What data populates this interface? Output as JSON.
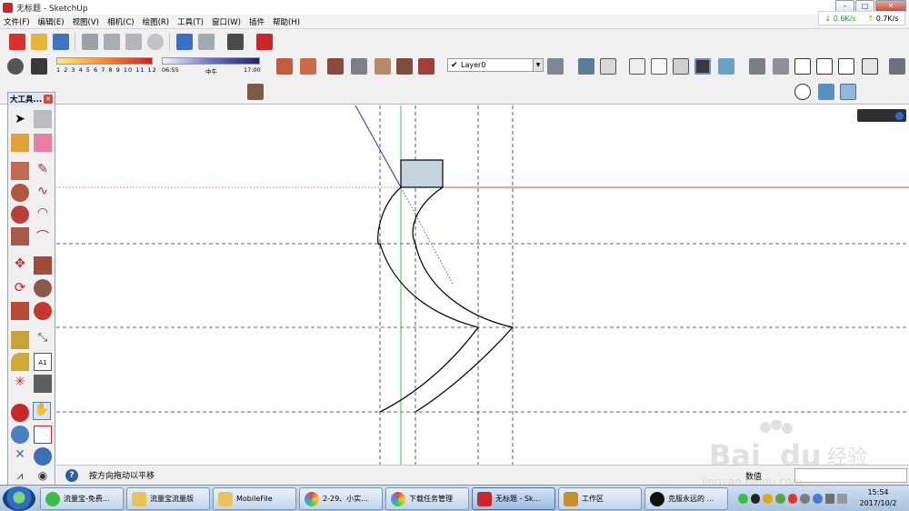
{
  "window": {
    "title": "无标题 - SketchUp",
    "controls": [
      "–",
      "□",
      "✕"
    ]
  },
  "net_widget": {
    "down": "0.6K/s",
    "up": "0.7K/s"
  },
  "menu": [
    "文件(F)",
    "编辑(E)",
    "视图(V)",
    "相机(C)",
    "绘图(R)",
    "工具(T)",
    "窗口(W)",
    "插件",
    "帮助(H)"
  ],
  "shadow_settings": {
    "month_ticks": "1 2 3 4 5 6 7 8 9 10 11 12",
    "time_start": "06:55",
    "time_mid": "中午",
    "time_end": "17:00"
  },
  "layer": {
    "current": "Layer0"
  },
  "palette": {
    "title": "大工具..."
  },
  "status": {
    "hint": "按方向拖动以平移",
    "measure_label": "数值",
    "measure_value": ""
  },
  "taskbar": {
    "items": [
      "流量宝-免费...",
      "流量宝流量版",
      "MobileFile",
      "2-29、小实...",
      "下载任务管理",
      "无标题 - Sk...",
      "工作区",
      "克服永远的 ..."
    ],
    "time": "15:54",
    "date": "2017/10/2"
  },
  "colors": {
    "red_axis": "#d94a4a",
    "green_axis": "#3cc33c",
    "blue_axis": "#2b2bbd",
    "face_fill": "#c5d5e0"
  }
}
